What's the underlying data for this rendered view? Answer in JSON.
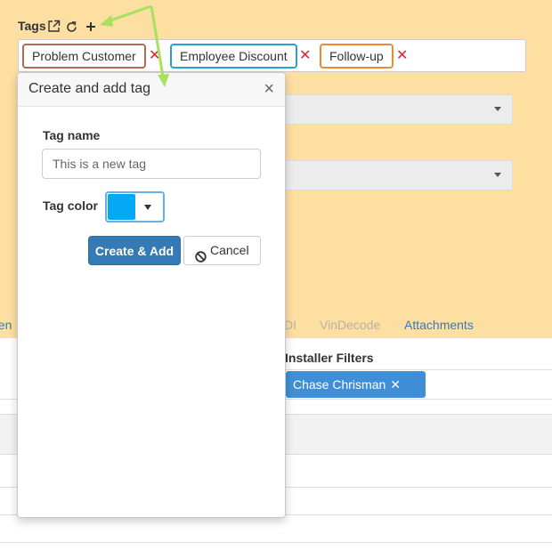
{
  "tags": {
    "label": "Tags",
    "actions": [
      "external-link-icon",
      "refresh-icon",
      "plus-icon"
    ],
    "chips": [
      {
        "label": "Problem Customer",
        "color": "#b5694d"
      },
      {
        "label": "Employee Discount",
        "color": "#2a9fd6"
      },
      {
        "label": "Follow-up",
        "color": "#f0882f"
      }
    ],
    "remove_symbol": "✕",
    "remove_color": "#e0242b"
  },
  "tabs": [
    {
      "label": "nen",
      "state": "link"
    },
    {
      "label": "DI",
      "state": "disabled"
    },
    {
      "label": "VinDecode",
      "state": "disabled"
    },
    {
      "label": "Attachments",
      "state": "link"
    }
  ],
  "installer_filters": {
    "label": "Installer Filters",
    "chip": "Chase Chrisman",
    "remove_symbol": "✕",
    "chip_color": "#3f8fd8"
  },
  "popover": {
    "title": "Create and add tag",
    "close_symbol": "×",
    "tag_name_label": "Tag name",
    "tag_name_value": "",
    "tag_name_placeholder": "This is a new tag",
    "tag_color_label": "Tag color",
    "tag_color_value": "#03a9f4",
    "create_button": "Create & Add",
    "cancel_button": "Cancel"
  },
  "colors": {
    "page_background": "#fedfa2",
    "annotation_arrow": "#a8e05f"
  }
}
